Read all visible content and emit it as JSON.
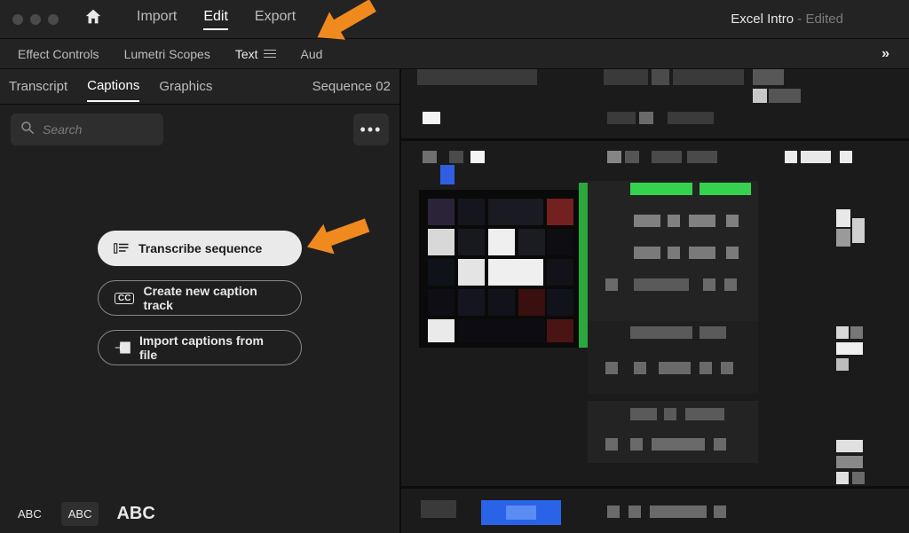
{
  "titlebar": {
    "project_name": "Excel Intro",
    "edited_suffix": " - Edited"
  },
  "top_tabs": [
    "Import",
    "Edit",
    "Export"
  ],
  "top_tabs_active": 1,
  "panel_tabs": [
    "Effect Controls",
    "Lumetri Scopes",
    "Text",
    "Aud"
  ],
  "panel_tabs_active": 2,
  "caption_tabs": [
    "Transcript",
    "Captions",
    "Graphics"
  ],
  "caption_tabs_active": 1,
  "sequence_name": "Sequence 02",
  "search": {
    "placeholder": "Search"
  },
  "actions": {
    "transcribe": "Transcribe sequence",
    "create_track": "Create new caption track",
    "import_file": "Import captions from file"
  },
  "footer": {
    "abc_small_1": "ABC",
    "abc_small_2": "ABC",
    "abc_big": "ABC"
  },
  "annotation_arrows": [
    {
      "points_to": "Text panel tab"
    },
    {
      "points_to": "Transcribe sequence button"
    }
  ]
}
